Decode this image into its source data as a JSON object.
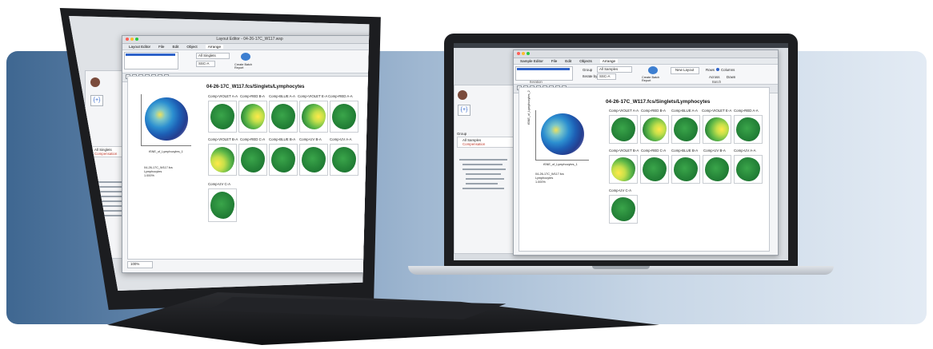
{
  "colors": {
    "accent": "#2f63c9",
    "cells_green": "#1f7a33",
    "hot_yellow": "#ffe94a",
    "backdrop_dark": "#3f6791"
  },
  "right": {
    "menu_tabs": [
      "Sample Editor",
      "File",
      "Edit",
      "Objects",
      "Arrange"
    ],
    "group_label": "Group",
    "group_value": "All Samples",
    "iterate_label": "Iterate by",
    "iterate_value": "SSC-A",
    "batch_label": "Create Batch Report",
    "new_layout": "New Layout",
    "rows_label": "Rows",
    "columns_label": "Columns",
    "across_label": "Across",
    "down_label": "Down",
    "sections": [
      "Iteration",
      "Batch"
    ],
    "plot_title": "04-26-17C_W117.fcs/Singlets/Lymphocytes",
    "x_axis": "tSNE_of_Lymphocytes_1",
    "y_axis": "tSNE_of_Lymphocytes_2",
    "caption_line1": "04-26-17C_W117.fcs",
    "caption_line2": "Lymphocytes",
    "caption_line3": "1.000%",
    "group_header": "Group",
    "tree_items": [
      "All Samples",
      "Compensation"
    ],
    "row1": [
      "Comp-VIOLET A-A",
      "Comp-RED B-A",
      "Comp-BLUE A-A",
      "Comp-VIOLET E-A",
      "Comp-RED A-A"
    ],
    "row2": [
      "Comp-VIOLET B-A",
      "Comp-RED C-A",
      "Comp-BLUE B-A",
      "Comp-UV B-A",
      "Comp-UV A-A"
    ],
    "row3": [
      "Comp-UV C-A"
    ]
  },
  "left": {
    "title": "Layout Editor - 04-26-17C_W117.wsp",
    "menu_tabs": [
      "Layout Editor",
      "File",
      "Edit",
      "Object",
      "Arrange"
    ],
    "group_value": "All Singlets",
    "iterate_value": "SSC-A",
    "batch_label": "Create Batch Report",
    "plot_title": "04-26-17C_W117.fcs/Singlets/Lymphocytes",
    "x_axis": "tSNE_of_Lymphocytes_1",
    "caption_line1": "04-26-17C_W117.fcs",
    "caption_line2": "Lymphocytes",
    "caption_line3": "1.000%",
    "tree_items": [
      "All Singlets",
      "Compensation"
    ],
    "row1": [
      "Comp-VIOLET A-A",
      "Comp-RED B-A",
      "Comp-BLUE A-A",
      "Comp-VIOLET E-A",
      "Comp-RED A-A"
    ],
    "row2": [
      "Comp-VIOLET B-A",
      "Comp-RED C-A",
      "Comp-BLUE B-A",
      "Comp-UV B-A",
      "Comp-UV A-A"
    ],
    "row3": [
      "Comp-UV C-A"
    ],
    "zoom": "100%"
  }
}
